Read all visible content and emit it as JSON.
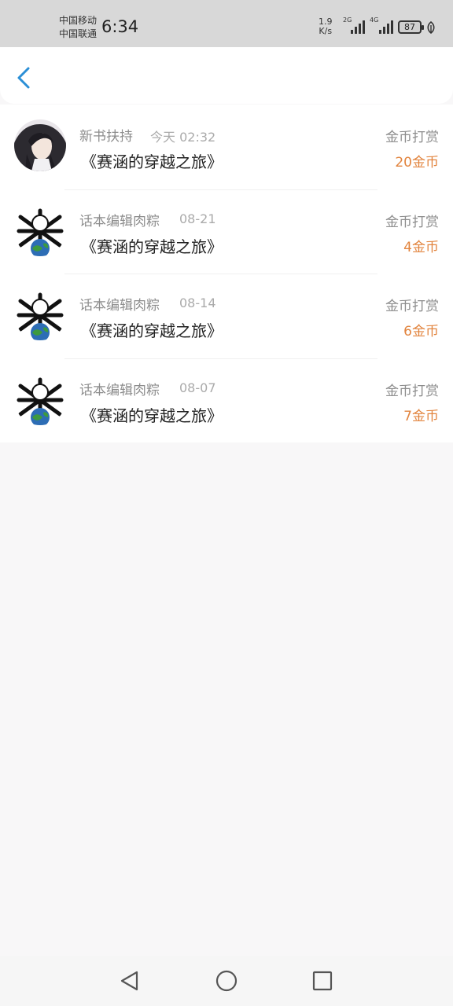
{
  "status_bar": {
    "carrier_1": "中国移动",
    "carrier_2": "中国联通",
    "time": "6:34",
    "speed_value": "1.9",
    "speed_unit": "K/s",
    "signal_1_label": "2G",
    "signal_2_label": "4G",
    "battery": "87"
  },
  "records": [
    {
      "sender": "新书扶持",
      "date": "今天 02:32",
      "book": "《赛涵的穿越之旅》",
      "type": "金币打赏",
      "amount": "20金币"
    },
    {
      "sender": "话本编辑肉粽",
      "date": "08-21",
      "book": "《赛涵的穿越之旅》",
      "type": "金币打赏",
      "amount": "4金币"
    },
    {
      "sender": "话本编辑肉粽",
      "date": "08-14",
      "book": "《赛涵的穿越之旅》",
      "type": "金币打赏",
      "amount": "6金币"
    },
    {
      "sender": "话本编辑肉粽",
      "date": "08-07",
      "book": "《赛涵的穿越之旅》",
      "type": "金币打赏",
      "amount": "7金币"
    }
  ],
  "colors": {
    "accent": "#2b8fd6",
    "reward": "#e2843e",
    "background": "#f8f7f8"
  },
  "icons": {
    "back": "chevron-left-icon",
    "nav_back": "triangle-back-icon",
    "nav_home": "circle-home-icon",
    "nav_recent": "square-recent-icon"
  }
}
